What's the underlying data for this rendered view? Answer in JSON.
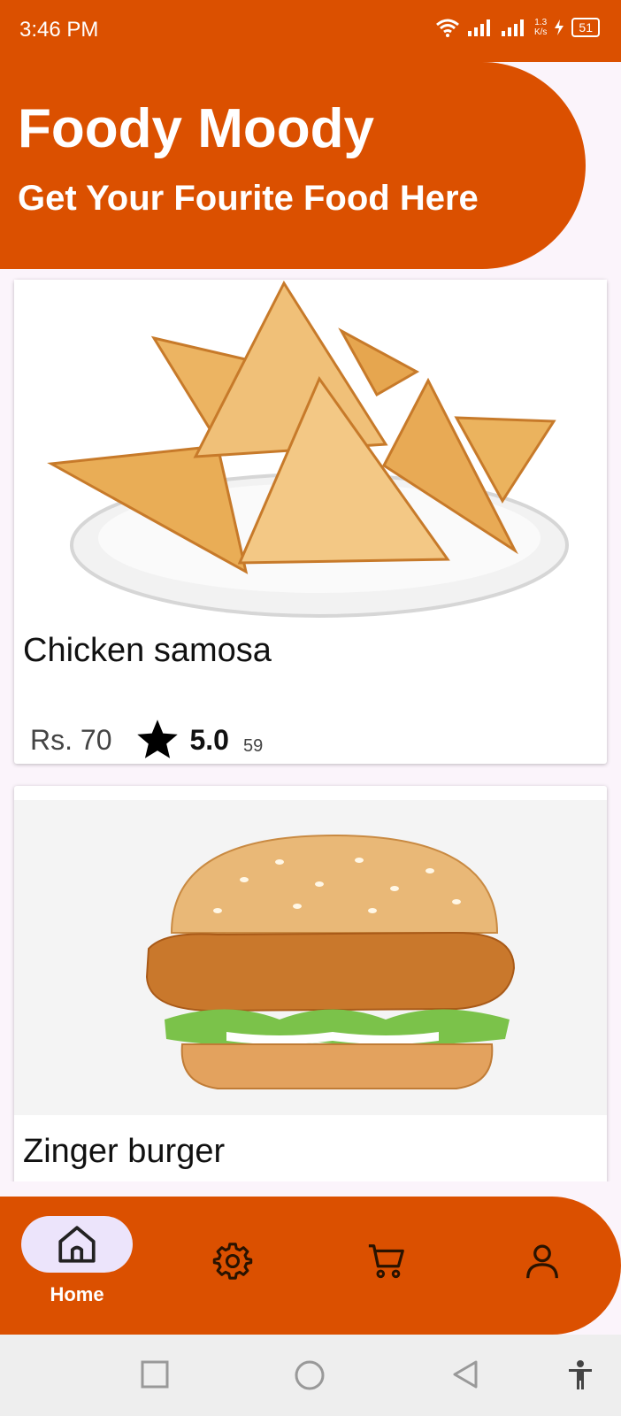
{
  "status_bar": {
    "time": "3:46 PM",
    "speed_top": "1.3",
    "speed_bottom": "K/s",
    "battery": "51"
  },
  "header": {
    "title": "Foody Moody",
    "subtitle": "Get Your Fourite Food Here"
  },
  "items": [
    {
      "name": "Chicken samosa",
      "price": "Rs. 70",
      "rating": "5.0",
      "reviews": "59"
    },
    {
      "name": "Zinger burger"
    }
  ],
  "bottom_nav": {
    "home_label": "Home"
  },
  "colors": {
    "brand": "#db5000",
    "pill": "#ece4fb"
  },
  "icons": [
    "home-icon",
    "gear-icon",
    "cart-icon",
    "person-icon"
  ]
}
